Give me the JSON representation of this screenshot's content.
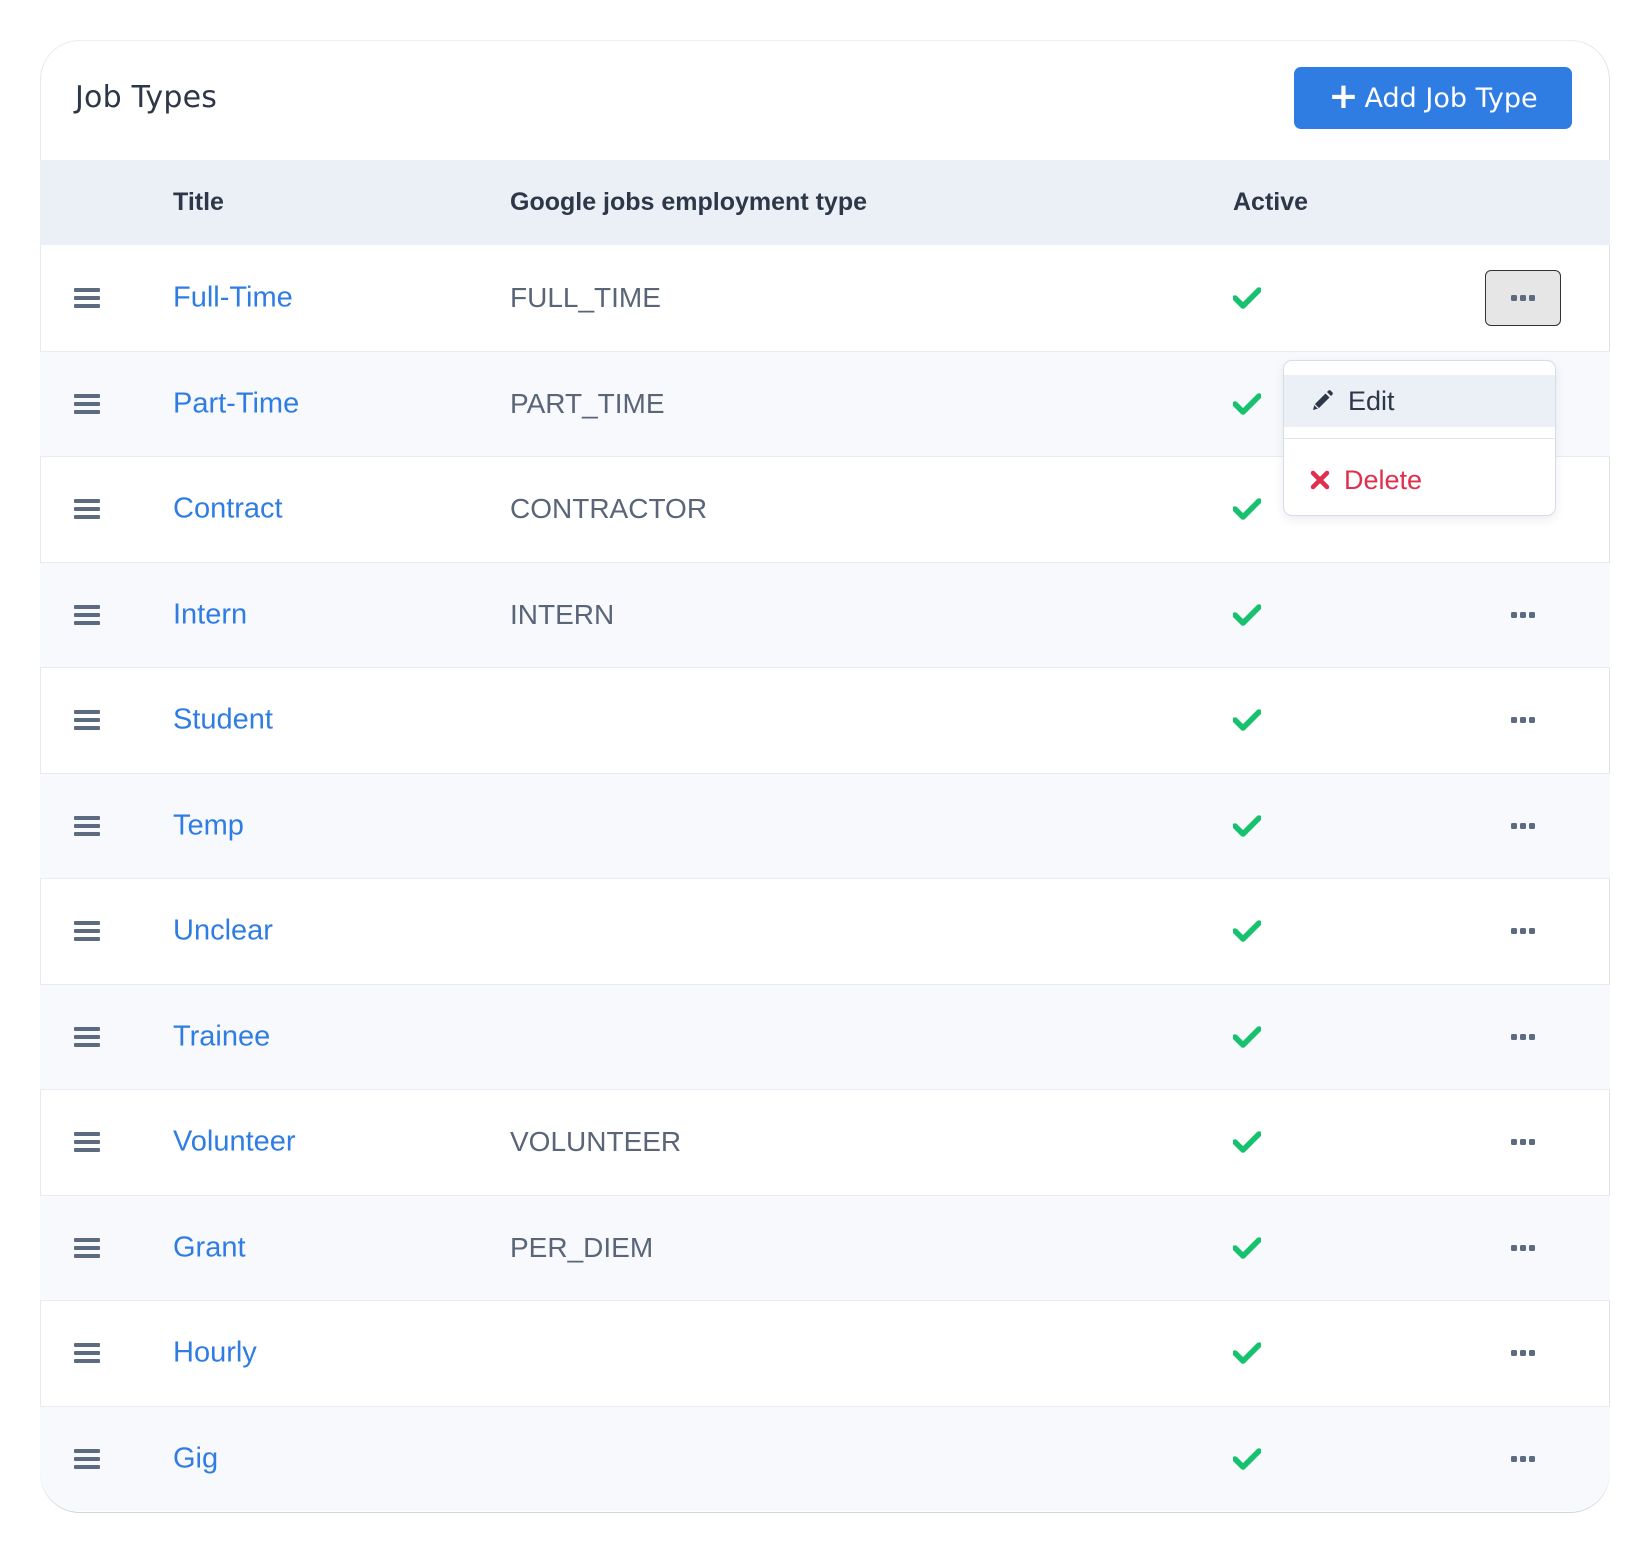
{
  "header": {
    "title": "Job Types",
    "add_button_icon": "plus-icon",
    "add_button_label": "Add Job Type"
  },
  "table": {
    "columns": [
      "",
      "Title",
      "Google jobs employment type",
      "Active",
      ""
    ],
    "rows": [
      {
        "title": "Full-Time",
        "google_type": "FULL_TIME",
        "active": true
      },
      {
        "title": "Part-Time",
        "google_type": "PART_TIME",
        "active": true
      },
      {
        "title": "Contract",
        "google_type": "CONTRACTOR",
        "active": true
      },
      {
        "title": "Intern",
        "google_type": "INTERN",
        "active": true
      },
      {
        "title": "Student",
        "google_type": "",
        "active": true
      },
      {
        "title": "Temp",
        "google_type": "",
        "active": true
      },
      {
        "title": "Unclear",
        "google_type": "",
        "active": true
      },
      {
        "title": "Trainee",
        "google_type": "",
        "active": true
      },
      {
        "title": "Volunteer",
        "google_type": "VOLUNTEER",
        "active": true
      },
      {
        "title": "Grant",
        "google_type": "PER_DIEM",
        "active": true
      },
      {
        "title": "Hourly",
        "google_type": "",
        "active": true
      },
      {
        "title": "Gig",
        "google_type": "",
        "active": true
      }
    ],
    "row_icons": {
      "drag": "drag-handle-icon",
      "active": "checkmark-icon",
      "actions": "ellipsis-icon"
    }
  },
  "dropdown": {
    "open_for_row": 0,
    "items": [
      {
        "label": "Edit",
        "icon": "pencil-icon"
      },
      {
        "label": "Delete",
        "icon": "x-icon"
      }
    ]
  },
  "colors": {
    "accent": "#2f7de3",
    "active_check": "#16c26e",
    "danger": "#e0304e",
    "header_bg": "#ebf0f7",
    "text": "#2d3748"
  }
}
